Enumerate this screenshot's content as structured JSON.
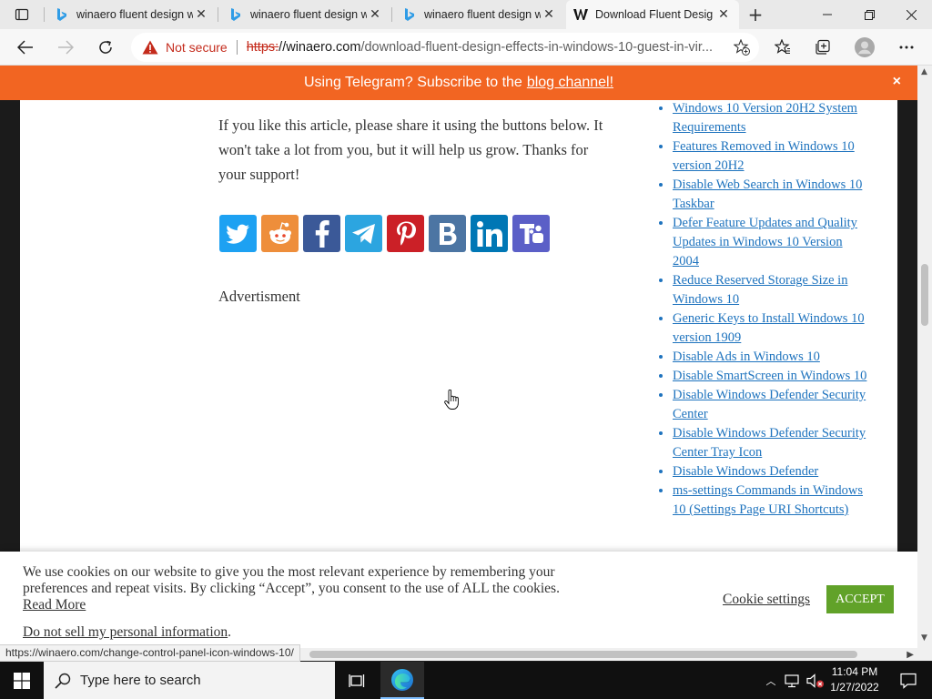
{
  "browser": {
    "tabs": [
      {
        "title": "winaero fluent design w",
        "active": false
      },
      {
        "title": "winaero fluent design w",
        "active": false
      },
      {
        "title": "winaero fluent design w",
        "active": false
      },
      {
        "title": "Download Fluent Desig",
        "active": true
      }
    ],
    "security_label": "Not secure",
    "url_scheme": "https:",
    "url_host_prefix": "//winaero.com",
    "url_path": "/download-fluent-design-effects-in-windows-10-guest-in-vir...",
    "colors": {
      "banner": "#f26522",
      "link": "#1e73be",
      "accept": "#61a229",
      "warning": "#c42b1c"
    }
  },
  "banner": {
    "text": "Using Telegram? Subscribe to the",
    "link": "blog channel!",
    "close": "×"
  },
  "article": {
    "paragraph": "If you like this article, please share it using the buttons below. It won't take a lot from you, but it will help us grow. Thanks for your support!",
    "share_buttons": [
      {
        "name": "twitter",
        "color": "#1da1f2"
      },
      {
        "name": "reddit",
        "color": "#ee8e3b"
      },
      {
        "name": "facebook",
        "color": "#3b5998"
      },
      {
        "name": "telegram",
        "color": "#2ca5e0"
      },
      {
        "name": "pinterest",
        "color": "#cb2027"
      },
      {
        "name": "vk",
        "color": "#4c75a3"
      },
      {
        "name": "linkedin",
        "color": "#0077b5"
      },
      {
        "name": "teams",
        "color": "#5b5fc7"
      }
    ],
    "advertisement": "Advertisment"
  },
  "sidebar": {
    "links": [
      "Windows 10 Version 20H2 System Requirements",
      "Features Removed in Windows 10 version 20H2",
      "Disable Web Search in Windows 10 Taskbar",
      "Defer Feature Updates and Quality Updates in Windows 10 Version 2004",
      "Reduce Reserved Storage Size in Windows 10",
      "Generic Keys to Install Windows 10 version 1909",
      "Disable Ads in Windows 10",
      "Disable SmartScreen in Windows 10",
      "Disable Windows Defender Security Center",
      "Disable Windows Defender Security Center Tray Icon",
      "Disable Windows Defender",
      "ms-settings Commands in Windows 10 (Settings Page URI Shortcuts)"
    ]
  },
  "cookie": {
    "text": "We use cookies on our website to give you the most relevant experience by remembering your preferences and repeat visits. By clicking “Accept”, you consent to the use of ALL the cookies.",
    "read_more": "Read More",
    "do_not_sell": "Do not sell my personal information",
    "do_not_sell_suffix": ".",
    "settings": "Cookie settings",
    "accept": "ACCEPT"
  },
  "status_url": "https://winaero.com/change-control-panel-icon-windows-10/",
  "taskbar": {
    "search_placeholder": "Type here to search",
    "time": "11:04 PM",
    "date": "1/27/2022"
  }
}
